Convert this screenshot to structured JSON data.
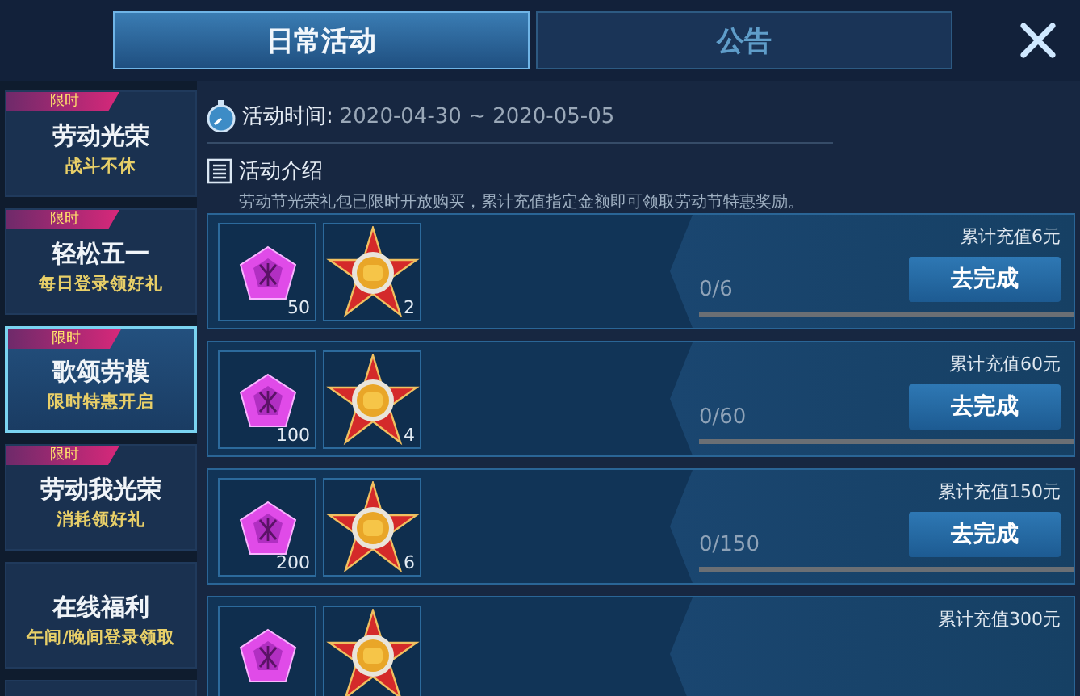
{
  "tabs": [
    {
      "label": "日常活动",
      "selected": true
    },
    {
      "label": "公告",
      "selected": false
    }
  ],
  "sidebar": {
    "items": [
      {
        "title": "劳动光荣",
        "subtitle": "战斗不休",
        "tag": "限时",
        "selected": false
      },
      {
        "title": "轻松五一",
        "subtitle": "每日登录领好礼",
        "tag": "限时",
        "selected": false
      },
      {
        "title": "歌颂劳模",
        "subtitle": "限时特惠开启",
        "tag": "限时",
        "selected": true
      },
      {
        "title": "劳动我光荣",
        "subtitle": "消耗领好礼",
        "tag": "限时",
        "selected": false
      },
      {
        "title": "在线福利",
        "subtitle": "午间/晚间登录领取",
        "selected": false
      },
      {
        "selected": false
      }
    ]
  },
  "activity": {
    "time_label": "活动时间:",
    "time_value": "2020-04-30 ~ 2020-05-05",
    "intro_label": "活动介绍",
    "intro_text": "劳动节光荣礼包已限时开放购买，累计充值指定金额即可领取劳动节特惠奖励。"
  },
  "tasks": [
    {
      "rewards": [
        {
          "kind": "gem",
          "count": "50"
        },
        {
          "kind": "medal",
          "count": "2"
        }
      ],
      "requirement": "累计充值6元",
      "progress": "0/6",
      "level": 0,
      "button": "去完成"
    },
    {
      "rewards": [
        {
          "kind": "gem",
          "count": "100"
        },
        {
          "kind": "medal",
          "count": "4"
        }
      ],
      "requirement": "累计充值60元",
      "progress": "0/60",
      "level": 0,
      "button": "去完成"
    },
    {
      "rewards": [
        {
          "kind": "gem",
          "count": "200"
        },
        {
          "kind": "medal",
          "count": "6"
        }
      ],
      "requirement": "累计充值150元",
      "progress": "0/150",
      "level": 0,
      "button": "去完成"
    },
    {
      "rewards": [
        {
          "kind": "gem"
        },
        {
          "kind": "medal"
        }
      ],
      "requirement": "累计充值300元"
    }
  ]
}
